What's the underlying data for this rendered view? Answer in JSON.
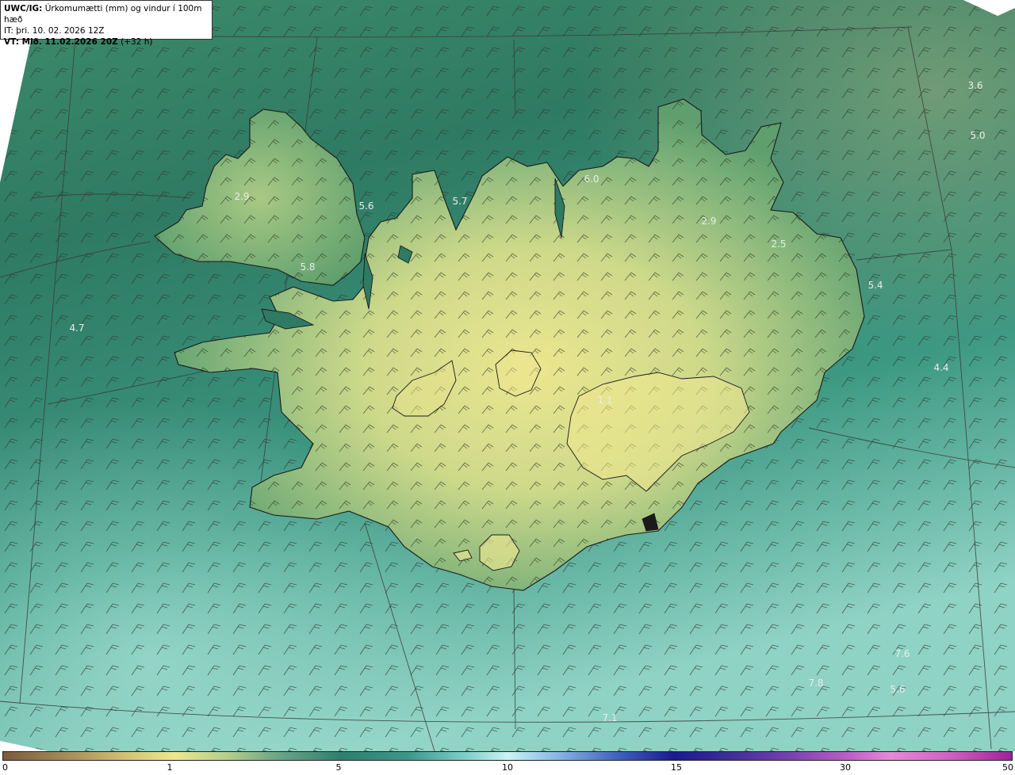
{
  "header": {
    "code": "UWC/IG:",
    "title": "Úrkomumætti (mm) og vindur í 100m hæð",
    "init_time": "IT: þri. 10. 02. 2026 12Z",
    "valid_prefix": "VT: Mið. 11.02.2026 20Z",
    "valid_suffix": "(+32 h)"
  },
  "map_labels": [
    {
      "id": "v1",
      "text": "3.6",
      "pos": [
        1230,
        108
      ]
    },
    {
      "id": "v2",
      "text": "5.0",
      "pos": [
        1233,
        171
      ]
    },
    {
      "id": "v3",
      "text": "6.0",
      "pos": [
        746,
        226
      ]
    },
    {
      "id": "v4",
      "text": "2.9",
      "pos": [
        305,
        248
      ]
    },
    {
      "id": "v5",
      "text": "5.6",
      "pos": [
        462,
        260
      ]
    },
    {
      "id": "v6",
      "text": "5.7",
      "pos": [
        580,
        254
      ]
    },
    {
      "id": "v7",
      "text": "2.9",
      "pos": [
        894,
        279
      ]
    },
    {
      "id": "v8",
      "text": "2.5",
      "pos": [
        982,
        308
      ]
    },
    {
      "id": "v9",
      "text": "5.8",
      "pos": [
        388,
        337
      ]
    },
    {
      "id": "v10",
      "text": "5.4",
      "pos": [
        1104,
        360
      ]
    },
    {
      "id": "v11",
      "text": "4.7",
      "pos": [
        97,
        414
      ]
    },
    {
      "id": "v12",
      "text": "4.4",
      "pos": [
        1187,
        464
      ]
    },
    {
      "id": "v13",
      "text": "1.1",
      "pos": [
        763,
        505
      ]
    },
    {
      "id": "v14",
      "text": "7.6",
      "pos": [
        1138,
        825
      ]
    },
    {
      "id": "v15",
      "text": "7.8",
      "pos": [
        1029,
        862
      ]
    },
    {
      "id": "v16",
      "text": "5.6",
      "pos": [
        1132,
        870
      ]
    },
    {
      "id": "v17",
      "text": "7.1",
      "pos": [
        769,
        906
      ]
    }
  ],
  "colorbar": {
    "ticks": [
      "0",
      "1",
      "5",
      "10",
      "15",
      "30",
      "50"
    ]
  },
  "colors": {
    "ocean_dark": "#2f7a62",
    "ocean_light": "#9fdccf",
    "land_low": "#5f9f6e",
    "land_high": "#e6e08c",
    "coastline": "#1a1a1a",
    "grid": "#3a3a3a"
  }
}
